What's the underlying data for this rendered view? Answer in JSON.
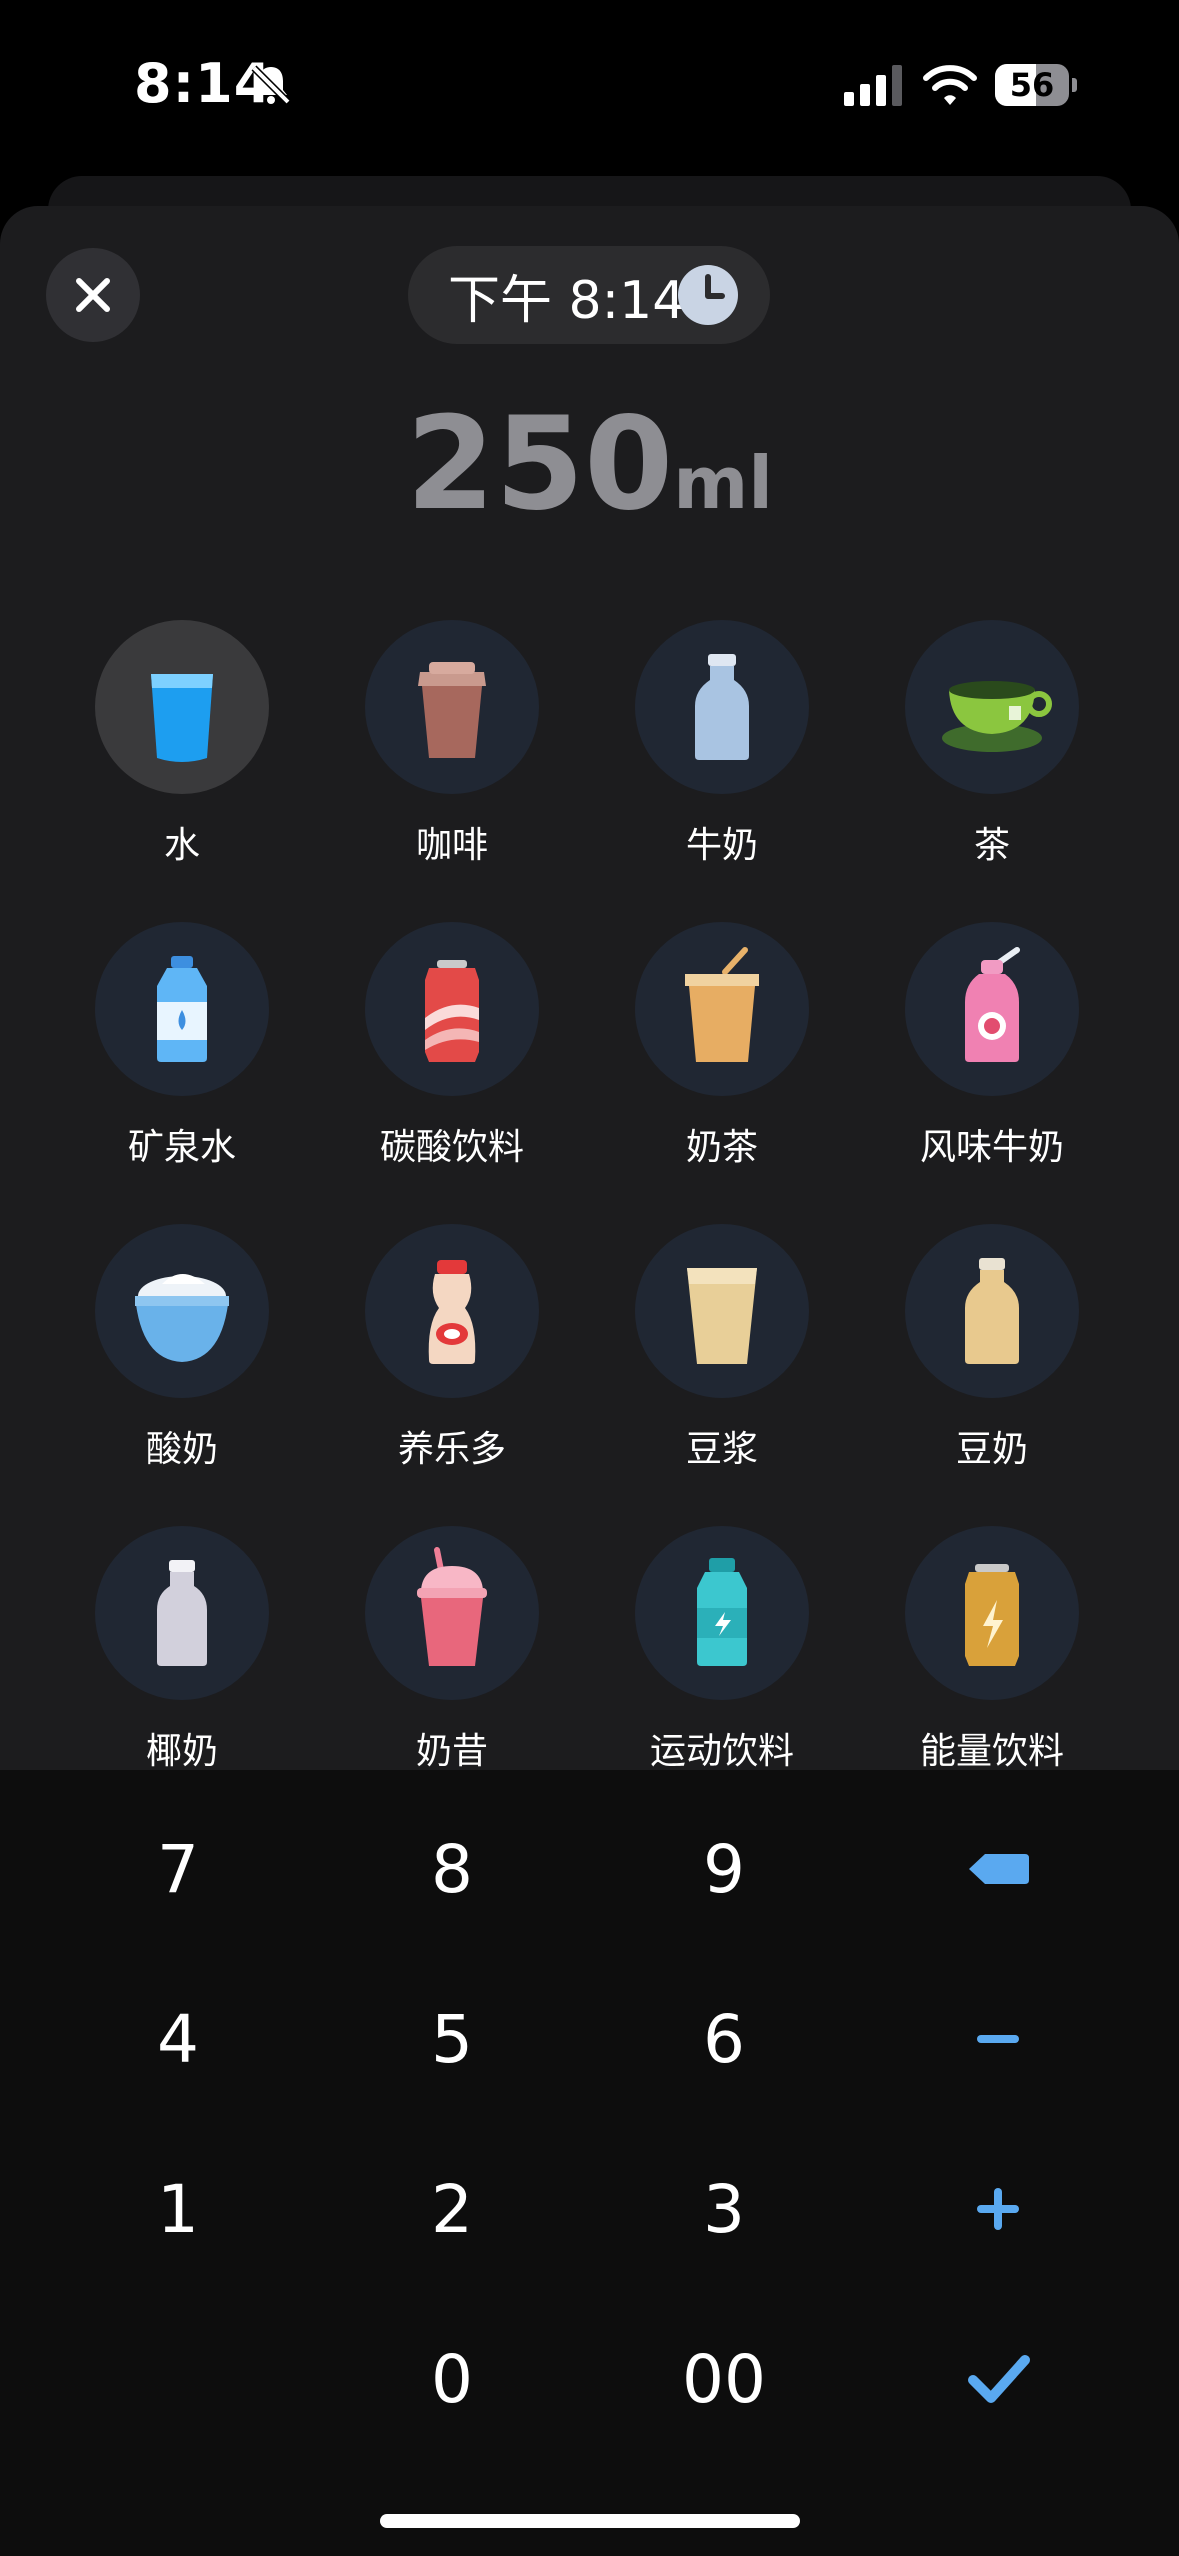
{
  "status_bar": {
    "time": "8:14",
    "battery": "56",
    "battery_level": 0.56
  },
  "header": {
    "time_label": "下午 8:14"
  },
  "amount": {
    "value": "250",
    "unit": "ml"
  },
  "drinks": [
    {
      "label": "水",
      "icon": "water-glass-icon",
      "selected": true
    },
    {
      "label": "咖啡",
      "icon": "coffee-cup-icon"
    },
    {
      "label": "牛奶",
      "icon": "milk-bottle-icon"
    },
    {
      "label": "茶",
      "icon": "tea-cup-icon"
    },
    {
      "label": "矿泉水",
      "icon": "mineral-water-bottle-icon"
    },
    {
      "label": "碳酸饮料",
      "icon": "soda-can-icon"
    },
    {
      "label": "奶茶",
      "icon": "milk-tea-cup-icon"
    },
    {
      "label": "风味牛奶",
      "icon": "flavored-milk-bottle-icon"
    },
    {
      "label": "酸奶",
      "icon": "yogurt-bowl-icon"
    },
    {
      "label": "养乐多",
      "icon": "yakult-bottle-icon"
    },
    {
      "label": "豆浆",
      "icon": "soy-milk-glass-icon"
    },
    {
      "label": "豆奶",
      "icon": "soy-milk-bottle-icon"
    },
    {
      "label": "椰奶",
      "icon": "coconut-milk-bottle-icon"
    },
    {
      "label": "奶昔",
      "icon": "milkshake-cup-icon"
    },
    {
      "label": "运动饮料",
      "icon": "sports-drink-bottle-icon"
    },
    {
      "label": "能量饮料",
      "icon": "energy-drink-can-icon"
    }
  ],
  "keypad": {
    "digits": [
      "7",
      "8",
      "9",
      "4",
      "5",
      "6",
      "1",
      "2",
      "3",
      "0",
      "00"
    ],
    "actions": [
      "backspace-icon",
      "minus-icon",
      "plus-icon",
      "checkmark-icon"
    ]
  },
  "colors": {
    "accent": "#5aa9f0",
    "background": "#1c1c1e",
    "keypad": "#0d0d0d"
  }
}
